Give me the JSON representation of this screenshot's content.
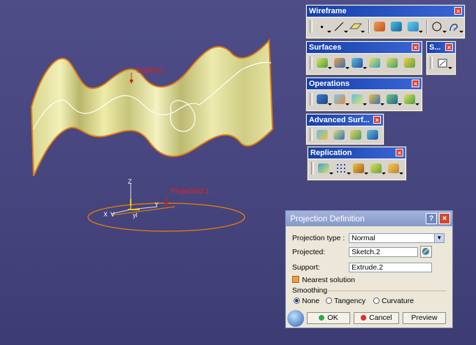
{
  "viewport": {
    "surface_label": "Support",
    "projection_label": "Projected 1",
    "axis_z": "Z",
    "axis_x": "X",
    "axis_y": "Y",
    "axis_yv": "yl",
    "axis_v": "V"
  },
  "toolbars": {
    "wireframe": {
      "title": "Wireframe"
    },
    "surfaces": {
      "title": "Surfaces"
    },
    "small": {
      "title": "S..."
    },
    "operations": {
      "title": "Operations"
    },
    "advanced": {
      "title": "Advanced Surf..."
    },
    "replication": {
      "title": "Replication"
    },
    "close_glyph": "×"
  },
  "dialog": {
    "title": "Projection Definition",
    "help": "?",
    "close": "×",
    "projection_type_label": "Projection type :",
    "projection_type_value": "Normal",
    "projected_label": "Projected:",
    "projected_value": "Sketch.2",
    "support_label": "Support:",
    "support_value": "Extrude.2",
    "nearest_label": "Nearest solution",
    "smoothing_label": "Smoothing",
    "opt_none": "None",
    "opt_tangency": "Tangency",
    "opt_curvature": "Curvature",
    "ok": "OK",
    "cancel": "Cancel",
    "preview": "Preview"
  },
  "colors": {
    "accent": "#1640a8",
    "curve": "#e08a20",
    "surface": "#ece9a8"
  }
}
